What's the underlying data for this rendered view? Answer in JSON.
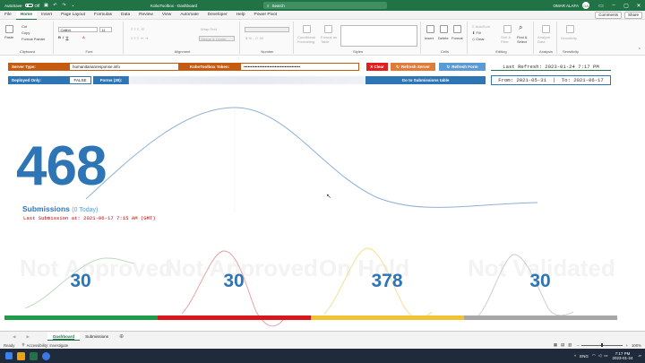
{
  "titlebar": {
    "autosave_label": "AutoSave",
    "autosave_state": "Off",
    "title": "KoboToolbox - Dashboard",
    "search_placeholder": "Search",
    "user_name": "OMAR ALAFA",
    "avatar_initials": "OA"
  },
  "tabs": [
    "File",
    "Home",
    "Insert",
    "Page Layout",
    "Formulas",
    "Data",
    "Review",
    "View",
    "Automate",
    "Developer",
    "Help",
    "Power Pivot"
  ],
  "tabs_active": "Home",
  "top_right": {
    "comments_label": "Comments",
    "share_label": "Share"
  },
  "ribbon": {
    "clipboard": {
      "paste": "Paste",
      "cut": "Cut",
      "copy": "Copy",
      "format_painter": "Format Painter",
      "label": "Clipboard"
    },
    "font": {
      "name": "Calibri",
      "size": "11",
      "label": "Font"
    },
    "alignment": {
      "wrap": "Wrap Text",
      "merge": "Merge & Center",
      "label": "Alignment"
    },
    "number": {
      "label": "Number"
    },
    "styles": {
      "conditional": "Conditional Formatting",
      "format_table": "Format as Table",
      "label": "Styles"
    },
    "cells": {
      "insert": "Insert",
      "delete": "Delete",
      "format": "Format",
      "label": "Cells"
    },
    "editing": {
      "autosum": "AutoSum",
      "fill": "Fill",
      "clear": "Clear",
      "sort": "Sort & Filter",
      "find": "Find & Select",
      "label": "Editing"
    },
    "analysis": {
      "analyze": "Analyze Data",
      "label": "Analysis"
    },
    "sensitivity": {
      "label": "Sensitivity",
      "btn": "Sensitivity"
    }
  },
  "controls": {
    "server_type_label": "Server Type:",
    "server_value": "humanitarianresponse.info",
    "token_label": "KoboToolbox Token:",
    "token_value": "••••••••••••••••••••••••••••••••••••••••",
    "clear_btn": "X Clear",
    "refresh_server_btn": "Refresh Server",
    "refresh_form_btn": "Refresh Form",
    "deployed_label": "Deployed Only:",
    "deployed_value": "FALSE",
    "forms_label": "Forms (30):",
    "goto_btn": "Go to Submissions table",
    "last_refresh": "Last Refresh: 2023-01-24 7:17 PM",
    "from_label": "From:",
    "from_date": "2021-05-31",
    "to_label": "To:",
    "to_date": "2021-06-17"
  },
  "summary": {
    "total": "468",
    "submissions_label": "Submissions",
    "today": "(0 Today)",
    "last_submission": "Last Submission at: 2021-06-17 7:15 AM (GMT)"
  },
  "cards": [
    {
      "value": "30",
      "label": "Not Approved",
      "color": "#1e9e4a"
    },
    {
      "value": "30",
      "label": "Not Approved",
      "color": "#d9161c"
    },
    {
      "value": "378",
      "label": "On Hold",
      "color": "#f1c232"
    },
    {
      "value": "30",
      "label": "Not Validated",
      "color": "#a6a6a6"
    }
  ],
  "sheets": [
    "Dashboard",
    "Submissions"
  ],
  "active_sheet": "Dashboard",
  "status": {
    "ready": "Ready",
    "accessibility": "Accessibility: Investigate",
    "zoom": "100%"
  },
  "taskbar": {
    "time": "7:17 PM",
    "date": "2023-01-24",
    "lang": "ENG"
  },
  "colors": {
    "excel_green": "#217346",
    "accent_blue": "#2e75b6",
    "accent_orange": "#c55a11",
    "clear_red": "#e02020"
  }
}
